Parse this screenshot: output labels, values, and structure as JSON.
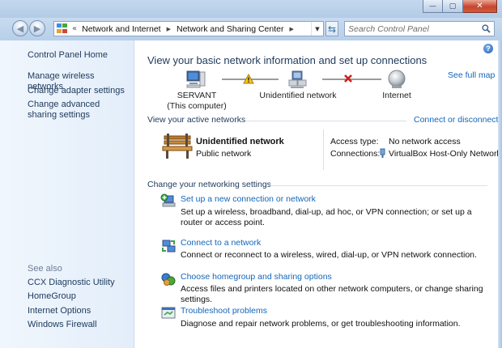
{
  "window": {
    "minimize_glyph": "—",
    "maximize_glyph": "▢",
    "close_glyph": "✕"
  },
  "navbar": {
    "back_glyph": "◀",
    "forward_glyph": "▶",
    "breadcrumb_overflow": "«",
    "breadcrumbs": [
      "Network and Internet",
      "Network and Sharing Center"
    ],
    "crumb_arrow": "▶",
    "address_dropdown": "▼",
    "refresh_glyph": "⇆",
    "search_placeholder": "Search Control Panel"
  },
  "sidebar": {
    "home": "Control Panel Home",
    "items": [
      "Manage wireless networks",
      "Change adapter settings",
      "Change advanced sharing settings"
    ],
    "see_also_label": "See also",
    "see_also": [
      "CCX Diagnostic Utility",
      "HomeGroup",
      "Internet Options",
      "Windows Firewall"
    ]
  },
  "main": {
    "help_glyph": "?",
    "title": "View your basic network information and set up connections",
    "see_full_map": "See full map",
    "map": {
      "computer": "SERVANT",
      "computer_sub": "(This computer)",
      "network": "Unidentified network",
      "internet": "Internet",
      "icons": [
        "computer-icon",
        "warning-icon",
        "network-icon",
        "error-x-icon",
        "globe-icon"
      ]
    },
    "active_networks": {
      "heading": "View your active networks",
      "action": "Connect or disconnect",
      "network_name": "Unidentified network",
      "network_type": "Public network",
      "access_type_label": "Access type:",
      "access_type_value": "No network access",
      "connections_label": "Connections:",
      "connections_value": "VirtualBox Host-Only Network"
    },
    "settings": {
      "heading": "Change your networking settings",
      "tasks": [
        {
          "title": "Set up a new connection or network",
          "description": "Set up a wireless, broadband, dial-up, ad hoc, or VPN connection; or set up a router or access point.",
          "icon": "new-connection-icon"
        },
        {
          "title": "Connect to a network",
          "description": "Connect or reconnect to a wireless, wired, dial-up, or VPN network connection.",
          "icon": "connect-network-icon"
        },
        {
          "title": "Choose homegroup and sharing options",
          "description": "Access files and printers located on other network computers, or change sharing settings.",
          "icon": "homegroup-icon"
        },
        {
          "title": "Troubleshoot problems",
          "description": "Diagnose and repair network problems, or get troubleshooting information.",
          "icon": "troubleshoot-icon"
        }
      ]
    }
  },
  "colors": {
    "link": "#1466b9",
    "heading": "#1e395b",
    "sidebar_bg": "#e8f1fb",
    "chrome": "#b9d1ea"
  }
}
